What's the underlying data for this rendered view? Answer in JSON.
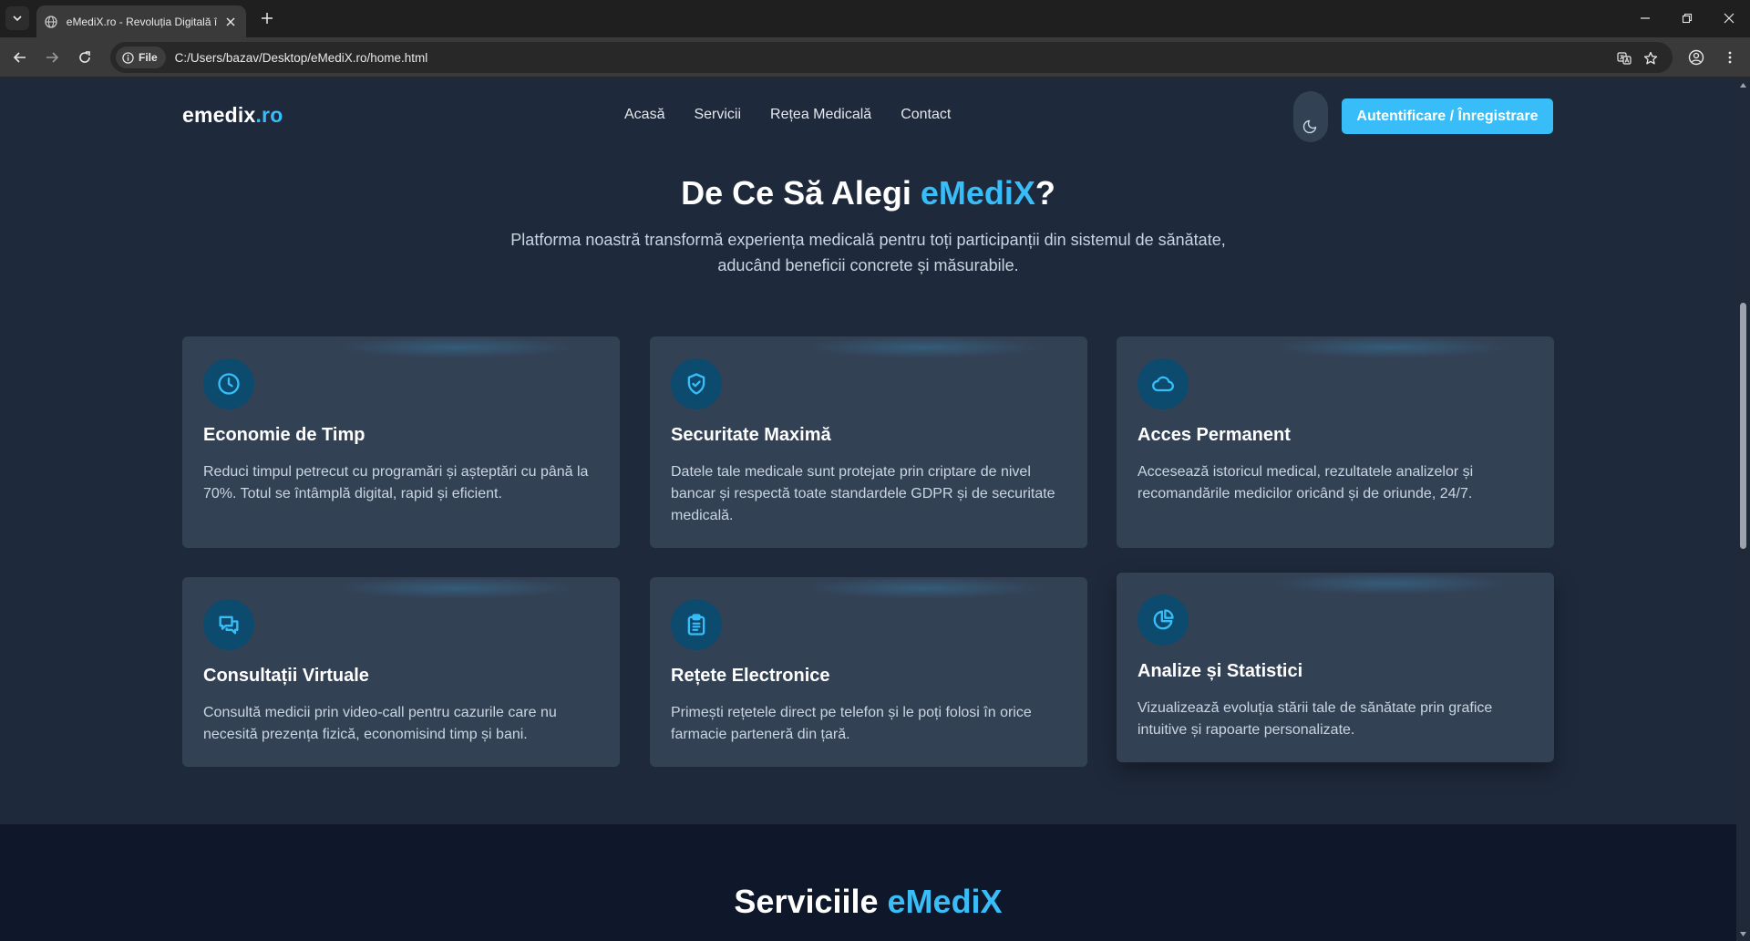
{
  "browser": {
    "tab_title": "eMediX.ro - Revoluția Digitală î",
    "site_chip_label": "File",
    "url": "C:/Users/bazav/Desktop/eMediX.ro/home.html"
  },
  "header": {
    "logo_main": "emedix",
    "logo_suffix": ".ro",
    "nav": [
      "Acasă",
      "Servicii",
      "Rețea Medicală",
      "Contact"
    ],
    "auth_button": "Autentificare / Înregistrare"
  },
  "why": {
    "title_prefix": "De Ce Să Alegi ",
    "title_accent": "eMediX",
    "title_suffix": "?",
    "subtitle": "Platforma noastră transformă experiența medicală pentru toți participanții din sistemul de sănătate, aducând beneficii concrete și măsurabile.",
    "cards": [
      {
        "icon": "clock-icon",
        "title": "Economie de Timp",
        "text": "Reduci timpul petrecut cu programări și așteptări cu până la 70%. Totul se întâmplă digital, rapid și eficient."
      },
      {
        "icon": "shield-check-icon",
        "title": "Securitate Maximă",
        "text": "Datele tale medicale sunt protejate prin criptare de nivel bancar și respectă toate standardele GDPR și de securitate medicală."
      },
      {
        "icon": "cloud-icon",
        "title": "Acces Permanent",
        "text": "Accesează istoricul medical, rezultatele analizelor și recomandările medicilor oricând și de oriunde, 24/7."
      },
      {
        "icon": "chat-bubbles-icon",
        "title": "Consultații Virtuale",
        "text": "Consultă medicii prin video-call pentru cazurile care nu necesită prezența fizică, economisind timp și bani."
      },
      {
        "icon": "clipboard-list-icon",
        "title": "Rețete Electronice",
        "text": "Primești rețetele direct pe telefon și le poți folosi în orice farmacie parteneră din țară."
      },
      {
        "icon": "pie-chart-icon",
        "title": "Analize și Statistici",
        "text": "Vizualizează evoluția stării tale de sănătate prin grafice intuitive și rapoarte personalizate."
      }
    ]
  },
  "services": {
    "title_prefix": "Serviciile ",
    "title_accent": "eMediX"
  },
  "colors": {
    "accent": "#38bdf8",
    "page_bg": "#1e293b",
    "card_bg": "#334155",
    "icon_bg": "#0c4a6e"
  }
}
